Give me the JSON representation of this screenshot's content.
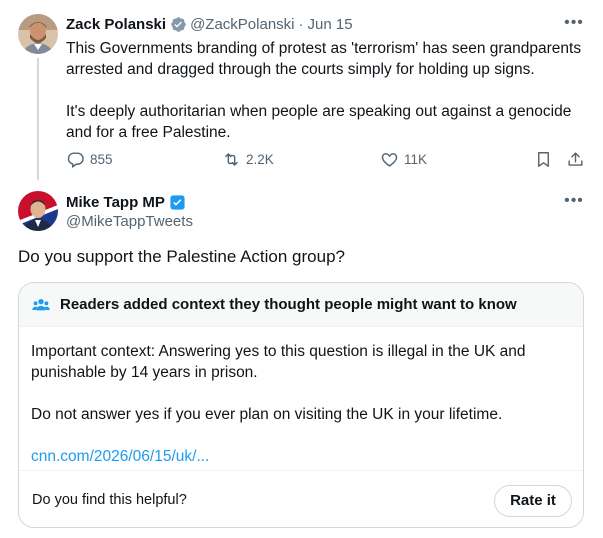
{
  "parent_tweet": {
    "author_name": "Zack Polanski",
    "handle": "@ZackPolanski",
    "separator": "·",
    "date": "Jun 15",
    "more_label": "•••",
    "paragraphs": [
      "This Governments branding of protest as 'terrorism' has seen grandparents arrested and dragged through the courts simply for holding up signs.",
      "It's deeply authoritarian when people are speaking out against a genocide and for a free Palestine."
    ],
    "stats": {
      "replies": "855",
      "reposts": "2.2K",
      "likes": "11K"
    },
    "icons": {
      "verified": "verified-grey-badge-icon",
      "reply": "reply-icon",
      "repost": "repost-icon",
      "like": "heart-icon",
      "bookmark": "bookmark-icon",
      "share": "share-icon"
    }
  },
  "reply_tweet": {
    "author_name": "Mike Tapp MP",
    "handle": "@MikeTappTweets",
    "more_label": "•••",
    "text": "Do you support the Palestine Action group?",
    "icons": {
      "verified": "verified-blue-badge-icon"
    }
  },
  "community_note": {
    "title": "Readers added context they thought people might want to know",
    "paragraphs": [
      "Important context: Answering yes to this question is illegal in the UK and punishable by 14 years in prison.",
      "Do not answer yes if you ever plan on visiting the UK in your lifetime."
    ],
    "link": "cnn.com/2026/06/15/uk/...",
    "helpful_question": "Do you find this helpful?",
    "rate_button": "Rate it",
    "icon": "people-icon"
  },
  "colors": {
    "text_primary": "#0f1419",
    "text_secondary": "#536471",
    "link": "#1d9bf0",
    "border": "#cfd9de",
    "note_header_bg": "#f7f9f9",
    "verified_blue": "#1d9bf0",
    "verified_grey": "#829aab"
  }
}
